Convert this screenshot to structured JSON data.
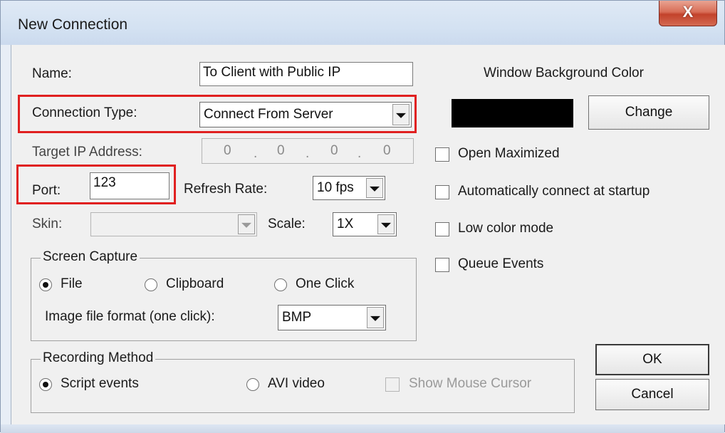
{
  "window": {
    "title": "New Connection",
    "close_glyph": "X"
  },
  "form": {
    "name_label": "Name:",
    "name_value": "To Client with Public IP",
    "connection_type_label": "Connection Type:",
    "connection_type_value": "Connect From Server",
    "target_ip_label": "Target IP Address:",
    "target_ip_octets": [
      "0",
      "0",
      "0",
      "0"
    ],
    "port_label": "Port:",
    "port_value": "123",
    "refresh_rate_label": "Refresh Rate:",
    "refresh_rate_value": "10 fps",
    "skin_label": "Skin:",
    "skin_value": "",
    "scale_label": "Scale:",
    "scale_value": "1X"
  },
  "screen_capture": {
    "group_label": "Screen Capture",
    "options": [
      "File",
      "Clipboard",
      "One Click"
    ],
    "selected": "File",
    "format_label": "Image file format (one click):",
    "format_value": "BMP"
  },
  "recording": {
    "group_label": "Recording Method",
    "options": [
      "Script events",
      "AVI video"
    ],
    "selected": "Script events",
    "show_cursor_label": "Show Mouse Cursor"
  },
  "appearance": {
    "bg_color_label": "Window Background Color",
    "bg_color_value": "#000000",
    "change_label": "Change"
  },
  "options": {
    "open_maximized": "Open Maximized",
    "auto_connect": "Automatically connect at startup",
    "low_color": "Low color mode",
    "queue_events": "Queue Events"
  },
  "buttons": {
    "ok": "OK",
    "cancel": "Cancel"
  },
  "highlight_color": "#e02020"
}
